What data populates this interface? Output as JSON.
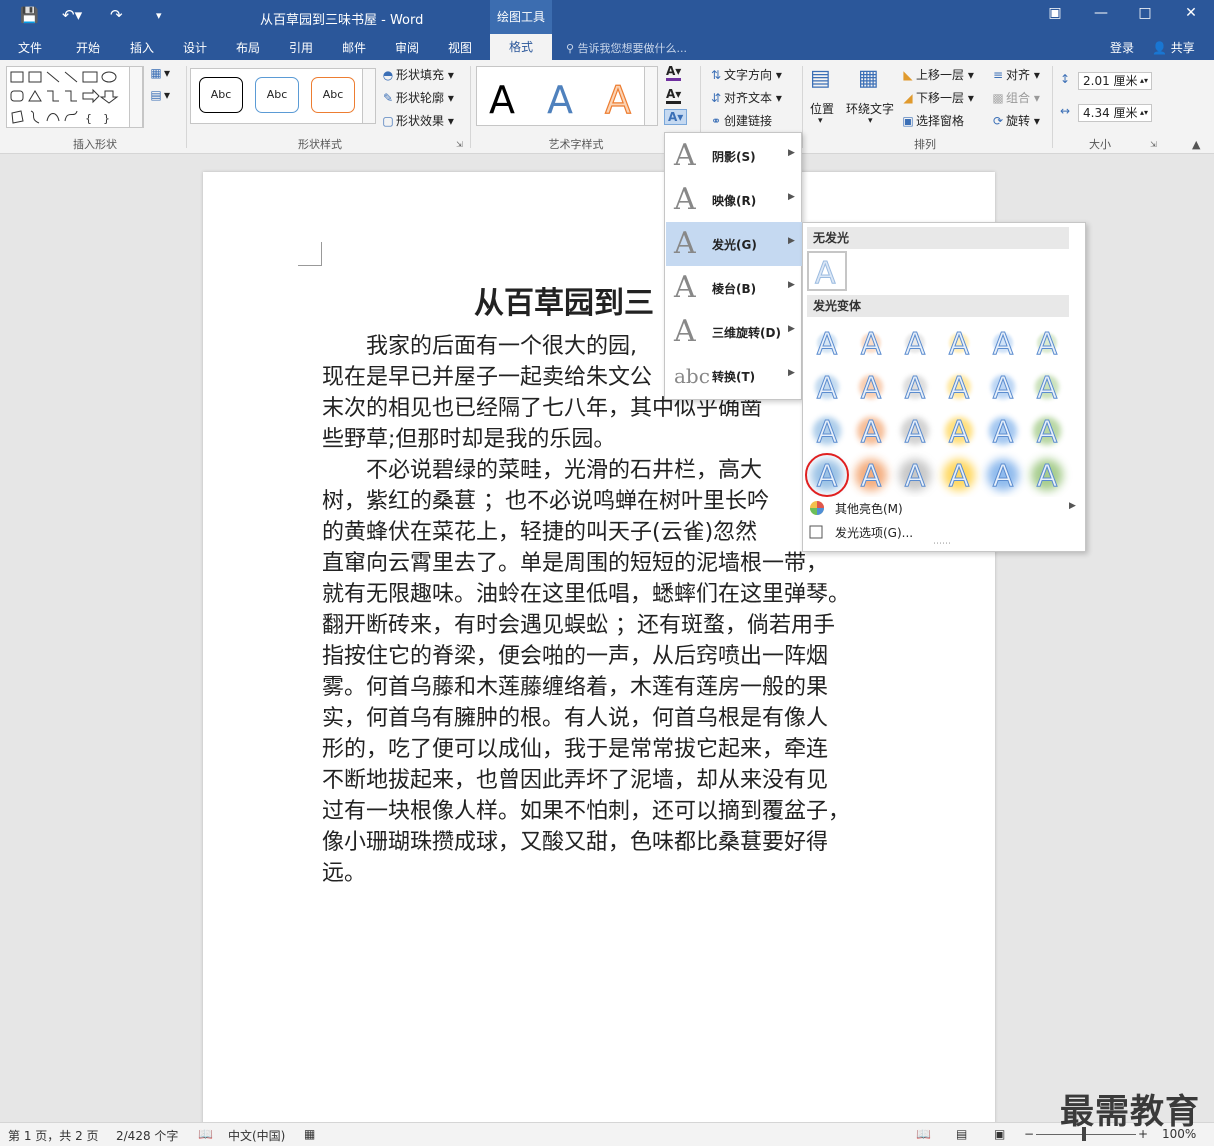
{
  "window": {
    "title": "从百草园到三味书屋 - Word",
    "tools_context": "绘图工具"
  },
  "tabs": [
    "文件",
    "开始",
    "插入",
    "设计",
    "布局",
    "引用",
    "邮件",
    "审阅",
    "视图",
    "格式"
  ],
  "tell_me": "告诉我您想要做什么...",
  "account": {
    "login": "登录",
    "share": "共享"
  },
  "ribbon": {
    "groups": {
      "insert_shapes": "插入形状",
      "shape_styles": "形状样式",
      "wordart_styles": "艺术字样式",
      "arrange": "排列",
      "size": "大小"
    },
    "shape_style_samples": [
      "Abc",
      "Abc",
      "Abc"
    ],
    "shape_fill": "形状填充",
    "shape_outline": "形状轮廓",
    "shape_effects": "形状效果",
    "text_direction": "文字方向",
    "align_text": "对齐文本",
    "create_link": "创建链接",
    "position": "位置",
    "wrap_text": "环绕文字",
    "bring_forward": "上移一层",
    "send_backward": "下移一层",
    "selection_pane": "选择窗格",
    "align": "对齐",
    "group": "组合",
    "rotate": "旋转",
    "height": "2.01 厘米",
    "width": "4.34 厘米"
  },
  "text_effects_menu": [
    {
      "label": "阴影(S)",
      "icon": "shadow-a-icon"
    },
    {
      "label": "映像(R)",
      "icon": "reflection-a-icon"
    },
    {
      "label": "发光(G)",
      "icon": "glow-a-icon"
    },
    {
      "label": "棱台(B)",
      "icon": "bevel-a-icon"
    },
    {
      "label": "三维旋转(D)",
      "icon": "rotation-3d-a-icon"
    },
    {
      "label": "转换(T)",
      "icon": "transform-abc-icon"
    }
  ],
  "glow_panel": {
    "no_glow": "无发光",
    "variants": "发光变体",
    "more_colors": "其他亮色(M)",
    "options": "发光选项(G)...",
    "colors": [
      "#5b9bd5",
      "#ed7d31",
      "#a5a5a5",
      "#ffc000",
      "#4a90e2",
      "#70ad47"
    ],
    "selected": {
      "row": 4,
      "col": 1
    }
  },
  "document": {
    "heading": "从百草园到三",
    "lines": [
      "　　我家的后面有一个很大的园,",
      "现在是早已并屋子一起卖给朱文公",
      "末次的相见也已经隔了七八年，其中似乎确凿",
      "些野草;但那时却是我的乐园。",
      "　　不必说碧绿的菜畦，光滑的石井栏，高大",
      "树，紫红的桑葚 ；也不必说鸣蝉在树叶里长吟",
      "的黄蜂伏在菜花上，轻捷的叫天子(云雀)忽然",
      "直窜向云霄里去了。单是周围的短短的泥墙根一带，",
      "就有无限趣味。油蛉在这里低唱，蟋蟀们在这里弹琴。",
      "翻开断砖来，有时会遇见蜈蚣 ；还有斑蝥，倘若用手",
      "指按住它的脊梁，便会啪的一声，从后窍喷出一阵烟",
      "雾。何首乌藤和木莲藤缠络着，木莲有莲房一般的果",
      "实，何首乌有臃肿的根。有人说，何首乌根是有像人",
      "形的，吃了便可以成仙，我于是常常拔它起来，牵连",
      "不断地拔起来，也曾因此弄坏了泥墙，却从来没有见",
      "过有一块根像人样。如果不怕刺，还可以摘到覆盆子，",
      "像小珊瑚珠攒成球，又酸又甜，色味都比桑葚要好得",
      "远。"
    ]
  },
  "status": {
    "page": "第 1 页，共 2 页",
    "words": "2/428 个字",
    "language": "中文(中国)",
    "zoom": "100%"
  },
  "watermark": "最需教育"
}
